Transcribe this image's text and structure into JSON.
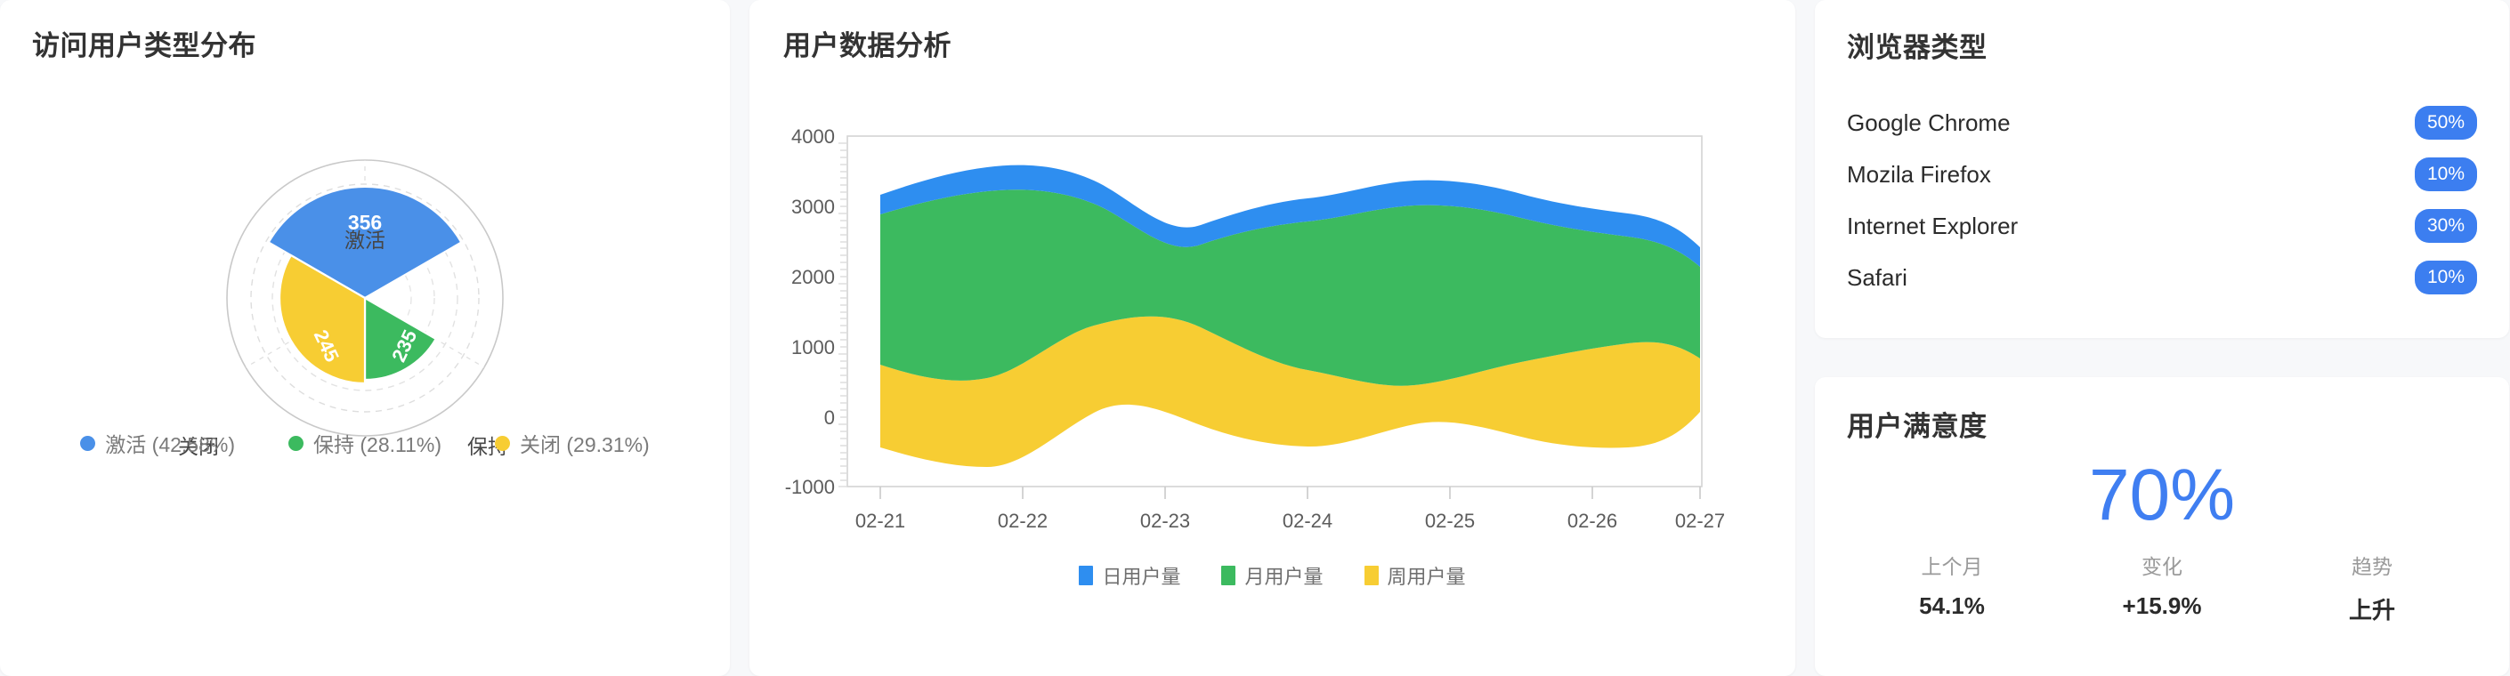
{
  "visitor_card": {
    "title": "访问用户类型分布",
    "axis_labels": {
      "top": "激活",
      "right": "保持",
      "left": "关闭"
    },
    "legend": [
      {
        "label": "激活 (42.58%)",
        "color": "#4a90e8"
      },
      {
        "label": "保持 (28.11%)",
        "color": "#3cba5f"
      },
      {
        "label": "关闭 (29.31%)",
        "color": "#f7cd33"
      }
    ],
    "chart_data": {
      "type": "pie",
      "subtype": "nightingale-rose",
      "title": "访问用户类型分布",
      "categories": [
        "激活",
        "保持",
        "关闭"
      ],
      "values": [
        356,
        235,
        245
      ],
      "percents": [
        42.58,
        28.11,
        29.31
      ],
      "colors": [
        "#4a90e8",
        "#3cba5f",
        "#f7cd33"
      ],
      "data_labels": [
        "356",
        "235",
        "245"
      ],
      "axis_labels": [
        "激活",
        "保持",
        "关闭"
      ],
      "legend_position": "bottom",
      "grid": true,
      "grid_style": "dashed-concentric-circles",
      "rmax": 400
    }
  },
  "analysis_card": {
    "title": "用户数据分析",
    "legend": [
      {
        "label": "日用户量",
        "color": "#2e8ef0"
      },
      {
        "label": "月用户量",
        "color": "#3cba5f"
      },
      {
        "label": "周用户量",
        "color": "#f7cd33"
      }
    ],
    "chart_data": {
      "type": "area",
      "stacked": true,
      "title": "用户数据分析",
      "xlabel": "",
      "ylabel": "",
      "x": [
        "02-21",
        "02-22",
        "02-23",
        "02-24",
        "02-25",
        "02-26",
        "02-27"
      ],
      "yticks": [
        -1000,
        0,
        1000,
        2000,
        3000,
        4000
      ],
      "ylim": [
        -1000,
        4000
      ],
      "grid": false,
      "legend_position": "bottom",
      "series": [
        {
          "name": "周用户量",
          "color": "#f7cd33",
          "values": [
            1020,
            740,
            1450,
            680,
            960,
            700,
            1450
          ]
        },
        {
          "name": "月用户量",
          "color": "#3cba5f",
          "values": [
            1900,
            2520,
            1240,
            2550,
            2080,
            2520,
            1300
          ]
        },
        {
          "name": "日用户量",
          "color": "#2e8ef0",
          "values": [
            110,
            270,
            290,
            250,
            130,
            290,
            290
          ]
        }
      ],
      "baseline_values": [
        560,
        30,
        580,
        70,
        380,
        50,
        560
      ]
    }
  },
  "browser_card": {
    "title": "浏览器类型",
    "rows": [
      {
        "name": "Google Chrome",
        "percent": "50%"
      },
      {
        "name": "Mozila Firefox",
        "percent": "10%"
      },
      {
        "name": "Internet Explorer",
        "percent": "30%"
      },
      {
        "name": "Safari",
        "percent": "10%"
      }
    ],
    "badge_color": "#3c7ef0",
    "chart_data": {
      "type": "table",
      "title": "浏览器类型",
      "categories": [
        "Google Chrome",
        "Mozila Firefox",
        "Internet Explorer",
        "Safari"
      ],
      "values": [
        50,
        10,
        30,
        10
      ],
      "unit": "%"
    }
  },
  "satisfaction_card": {
    "title": "用户满意度",
    "big_value": "70%",
    "accent_color": "#3f7ef1",
    "stats": [
      {
        "label": "上个月",
        "value": "54.1%"
      },
      {
        "label": "变化",
        "value": "+15.9%"
      },
      {
        "label": "趋势",
        "value": "上升"
      }
    ]
  }
}
